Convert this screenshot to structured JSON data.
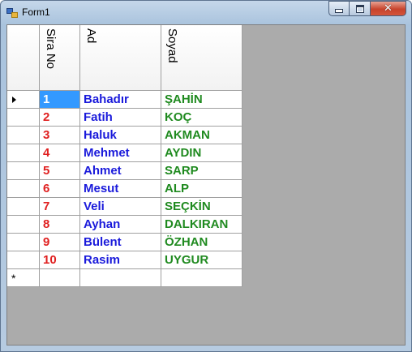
{
  "window": {
    "title": "Form1",
    "close_glyph": "✕"
  },
  "grid": {
    "columns": [
      {
        "key": "sira",
        "label": "Sira No",
        "color": "#e02020"
      },
      {
        "key": "ad",
        "label": "Ad",
        "color": "#1a1adb"
      },
      {
        "key": "soyad",
        "label": "Soyad",
        "color": "#1f8a1f"
      }
    ],
    "rows": [
      {
        "sira": "1",
        "ad": "Bahadır",
        "soyad": "ŞAHİN"
      },
      {
        "sira": "2",
        "ad": "Fatih",
        "soyad": "KOÇ"
      },
      {
        "sira": "3",
        "ad": "Haluk",
        "soyad": "AKMAN"
      },
      {
        "sira": "4",
        "ad": "Mehmet",
        "soyad": "AYDIN"
      },
      {
        "sira": "5",
        "ad": "Ahmet",
        "soyad": "SARP"
      },
      {
        "sira": "6",
        "ad": "Mesut",
        "soyad": "ALP"
      },
      {
        "sira": "7",
        "ad": "Veli",
        "soyad": "SEÇKİN"
      },
      {
        "sira": "8",
        "ad": "Ayhan",
        "soyad": "DALKIRAN"
      },
      {
        "sira": "9",
        "ad": "Bülent",
        "soyad": "ÖZHAN"
      },
      {
        "sira": "10",
        "ad": "Rasim",
        "soyad": "UYGUR"
      }
    ],
    "selected_row": 0,
    "current_row_icon": "current-row-arrow-icon",
    "new_row_glyph": "*",
    "selection_color": "#3399ff"
  }
}
